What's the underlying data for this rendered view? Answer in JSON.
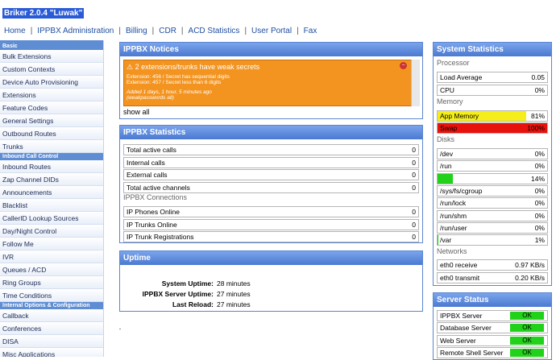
{
  "app_title": "Briker 2.0.4 \"Luwak\"",
  "topnav": [
    "Home",
    "IPPBX Administration",
    "Billing",
    "CDR",
    "ACD Statistics",
    "User Portal",
    "Fax"
  ],
  "sidebar": {
    "sections": [
      {
        "header": "Basic",
        "items": [
          "Bulk Extensions",
          "Custom Contexts",
          "Device Auto Provisioning",
          "Extensions",
          "Feature Codes",
          "General Settings",
          "Outbound Routes",
          "Trunks"
        ]
      },
      {
        "header": "Inbound Call Control",
        "items": [
          "Inbound Routes",
          "Zap Channel DIDs",
          "Announcements",
          "Blacklist",
          "CallerID Lookup Sources",
          "Day/Night Control",
          "Follow Me",
          "IVR",
          "Queues / ACD",
          "Ring Groups",
          "Time Conditions"
        ]
      },
      {
        "header": "Internal Options & Configuration",
        "items": [
          "Callback",
          "Conferences",
          "DISA",
          "Misc Applications"
        ]
      }
    ]
  },
  "notices": {
    "title": "IPPBX Notices",
    "alert_title": "2 extensions/trunks have weak secrets",
    "lines": [
      "Extension: 456 / Secret has sequential digits",
      "Extension: 457 / Secret less than 6 digits"
    ],
    "added": "Added 1 days, 1 hour, 5 minutes ago",
    "link": "(weakpasswords all)",
    "show_all": "show all"
  },
  "stats": {
    "title": "IPPBX Statistics",
    "rows": [
      {
        "label": "Total active calls",
        "value": "0"
      },
      {
        "label": "Internal calls",
        "value": "0"
      },
      {
        "label": "External calls",
        "value": "0"
      },
      {
        "label": "Total active channels",
        "value": "0"
      }
    ],
    "connections_label": "IPPBX Connections",
    "conn_rows": [
      {
        "label": "IP Phones Online",
        "value": "0"
      },
      {
        "label": "IP Trunks Online",
        "value": "0"
      },
      {
        "label": "IP Trunk Registrations",
        "value": "0"
      }
    ]
  },
  "uptime": {
    "title": "Uptime",
    "rows": [
      {
        "label": "System Uptime:",
        "value": "28 minutes"
      },
      {
        "label": "IPPBX Server Uptime:",
        "value": "27 minutes"
      },
      {
        "label": "Last Reload:",
        "value": "27 minutes"
      }
    ]
  },
  "system": {
    "title": "System Statistics",
    "processor_label": "Processor",
    "load_label": "Load Average",
    "load_value": "0.05",
    "cpu_label": "CPU",
    "cpu_value": "0%",
    "memory_label": "Memory",
    "app_mem_label": "App Memory",
    "app_mem_value": "81%",
    "swap_label": "Swap",
    "swap_value": "100%",
    "disks_label": "Disks",
    "disks": [
      {
        "label": "/dev",
        "value": "0%",
        "fill": 0
      },
      {
        "label": "/run",
        "value": "0%",
        "fill": 0
      },
      {
        "label": "",
        "value": "14%",
        "fill": 0.14
      },
      {
        "label": "/sys/fs/cgroup",
        "value": "0%",
        "fill": 0
      },
      {
        "label": "/run/lock",
        "value": "0%",
        "fill": 0
      },
      {
        "label": "/run/shm",
        "value": "0%",
        "fill": 0
      },
      {
        "label": "/run/user",
        "value": "0%",
        "fill": 0
      },
      {
        "label": "/var",
        "value": "1%",
        "fill": 0.01
      }
    ],
    "networks_label": "Networks",
    "net_rows": [
      {
        "label": "eth0 receive",
        "value": "0.97 KB/s"
      },
      {
        "label": "eth0 transmit",
        "value": "0.20 KB/s"
      }
    ]
  },
  "server_status": {
    "title": "Server Status",
    "rows": [
      {
        "label": "IPPBX Server",
        "value": "OK"
      },
      {
        "label": "Database Server",
        "value": "OK"
      },
      {
        "label": "Web Server",
        "value": "OK"
      },
      {
        "label": "Remote Shell Server",
        "value": "OK"
      }
    ]
  },
  "colors": {
    "ok": "#22d11a",
    "mem_bar": "#f5ee1a",
    "swap_bar": "#e8120c",
    "disk_bar": "#22d11a"
  }
}
